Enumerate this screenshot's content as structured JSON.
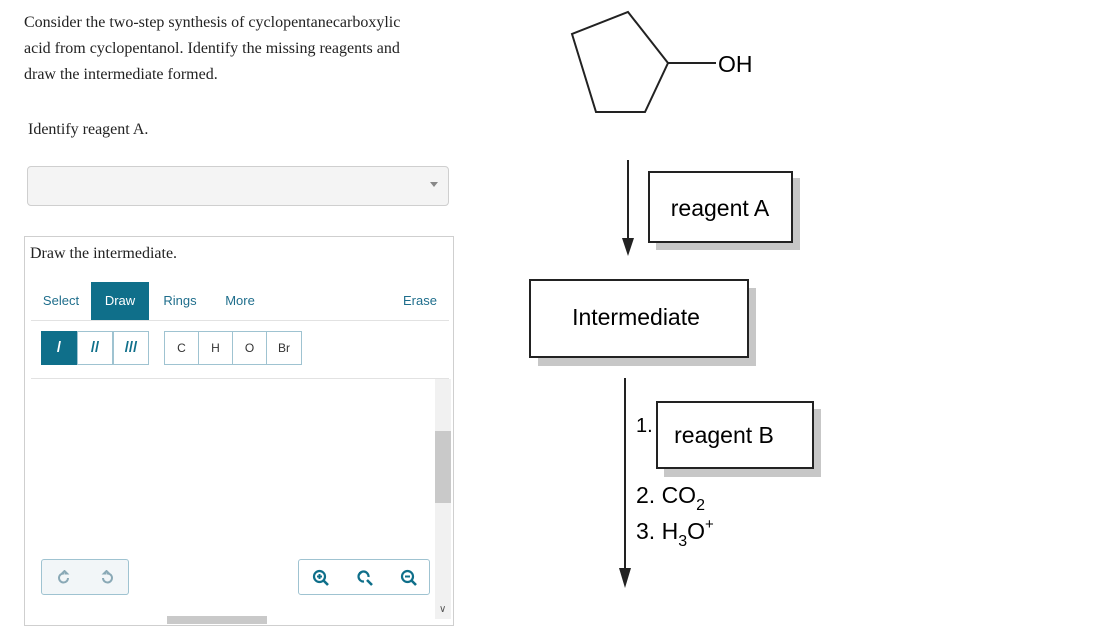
{
  "question": {
    "line1": "Consider the two-step synthesis of cyclopentanecarboxylic",
    "line2": "acid from cyclopentanol. Identify the missing reagents and",
    "line3": "draw the intermediate formed."
  },
  "reagent_a_prompt": "Identify reagent A.",
  "reagent_a_select": {
    "value": ""
  },
  "drawing_panel": {
    "title": "Draw the intermediate.",
    "tabs": [
      "Select",
      "Draw",
      "Rings",
      "More"
    ],
    "active_tab": "Draw",
    "erase_label": "Erase",
    "bond_tools": [
      "/",
      "//",
      "///"
    ],
    "atom_tools": [
      "C",
      "H",
      "O",
      "Br"
    ],
    "undo_icon": "undo-icon",
    "redo_icon": "redo-icon",
    "zoom_in_icon": "zoom-in-icon",
    "zoom_reset_icon": "zoom-reset-icon",
    "zoom_out_icon": "zoom-out-icon"
  },
  "scheme": {
    "starting_material_group": "OH",
    "reagent_a_box": "reagent A",
    "intermediate_box": "Intermediate",
    "step1_number": "1.",
    "reagent_b_box": "reagent B",
    "step2": "2. CO",
    "step2_sub": "2",
    "step3_prefix": "3. H",
    "step3_sub": "3",
    "step3_mid": "O",
    "step3_sup": "+"
  },
  "colors": {
    "accent": "#0f6f8a",
    "tab_text": "#1f6e8c",
    "border": "#cfcfcf"
  }
}
